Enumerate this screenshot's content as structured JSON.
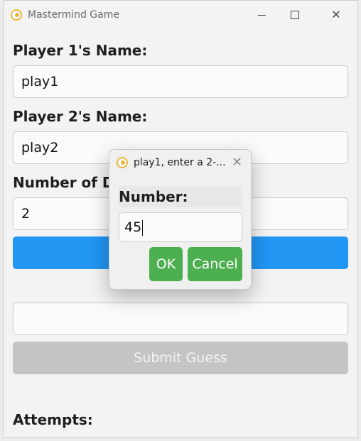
{
  "window": {
    "title": "Mastermind Game",
    "controls": {
      "minimize": "",
      "maximize": "",
      "close": "✕"
    }
  },
  "form": {
    "player1_label": "Player 1's Name:",
    "player1_value": "play1",
    "player2_label": "Player 2's Name:",
    "player2_value": "play2",
    "digits_label": "Number of D",
    "digits_value": "2",
    "primary_button_label": "",
    "guess_value": "",
    "submit_label": "Submit Guess",
    "attempts_label": "Attempts:"
  },
  "dialog": {
    "title": "play1, enter a 2-...",
    "close": "✕",
    "field_label": "Number:",
    "field_value": "45",
    "ok_label": "OK",
    "cancel_label": "Cancel"
  },
  "colors": {
    "primary": "#2196f3",
    "success": "#4caf50",
    "disabled": "#c4c4c4",
    "icon_accent": "#f0b43c"
  }
}
